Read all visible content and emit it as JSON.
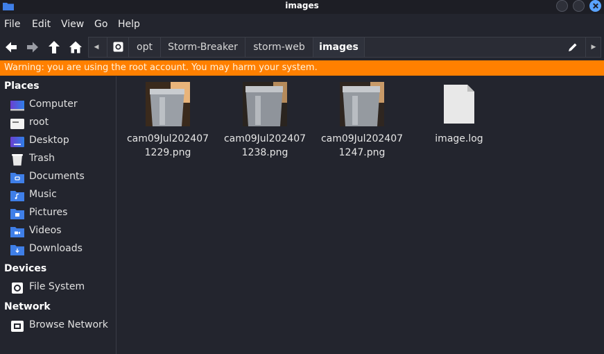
{
  "window": {
    "title": "images"
  },
  "menu": [
    "File",
    "Edit",
    "View",
    "Go",
    "Help"
  ],
  "path": {
    "crumbs": [
      "opt",
      "Storm-Breaker",
      "storm-web",
      "images"
    ],
    "active": "images"
  },
  "warning": "Warning: you are using the root account. You may harm your system.",
  "colors": {
    "accent": "#5aa3ff",
    "warning": "#ff8000",
    "background": "#23252e",
    "folder": "#3f7fe8"
  },
  "sidebar": {
    "places_heading": "Places",
    "places": [
      {
        "label": "Computer",
        "icon": "computer-icon"
      },
      {
        "label": "root",
        "icon": "home-folder-icon"
      },
      {
        "label": "Desktop",
        "icon": "desktop-icon"
      },
      {
        "label": "Trash",
        "icon": "trash-icon"
      },
      {
        "label": "Documents",
        "icon": "documents-folder-icon"
      },
      {
        "label": "Music",
        "icon": "music-folder-icon"
      },
      {
        "label": "Pictures",
        "icon": "pictures-folder-icon"
      },
      {
        "label": "Videos",
        "icon": "videos-folder-icon"
      },
      {
        "label": "Downloads",
        "icon": "downloads-folder-icon"
      }
    ],
    "devices_heading": "Devices",
    "devices": [
      {
        "label": "File System",
        "icon": "drive-icon"
      }
    ],
    "network_heading": "Network",
    "network": [
      {
        "label": "Browse Network",
        "icon": "network-icon"
      }
    ]
  },
  "files": [
    {
      "name": "cam09Jul2024071229.png",
      "type": "image"
    },
    {
      "name": "cam09Jul2024071238.png",
      "type": "image"
    },
    {
      "name": "cam09Jul2024071247.png",
      "type": "image"
    },
    {
      "name": "image.log",
      "type": "text"
    }
  ]
}
